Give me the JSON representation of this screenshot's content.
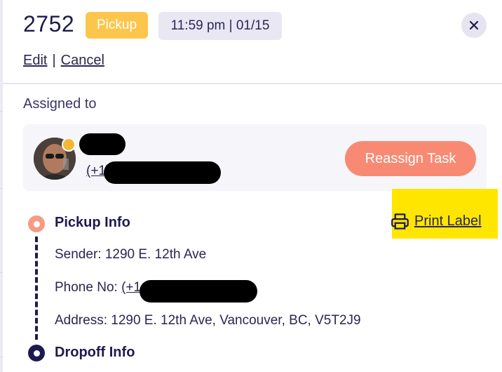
{
  "header": {
    "order_id": "2752",
    "task_type": "Pickup",
    "time_date": "11:59 pm | 01/15",
    "edit_label": "Edit",
    "separator": "|",
    "cancel_label": "Cancel"
  },
  "assigned": {
    "label": "Assigned to",
    "phone_prefix": "(+1)",
    "reassign_label": "Reassign Task",
    "status_color": "#f7b733"
  },
  "print_label": "Print Label",
  "pickup": {
    "title": "Pickup Info",
    "sender_label": "Sender: ",
    "sender_value": "1290 E. 12th Ave",
    "phone_label": "Phone No: ",
    "phone_prefix": "(+1",
    "address_label": "Address: ",
    "address_value": "1290 E. 12th Ave, Vancouver, BC, V5T2J9"
  },
  "dropoff": {
    "title": "Dropoff Info"
  },
  "colors": {
    "pickup_badge": "#fcc64c",
    "accent": "#f88a74",
    "dark": "#1e1a4d",
    "highlight": "#ffe600"
  },
  "icons": {
    "close": "close-icon",
    "print": "printer-icon"
  }
}
